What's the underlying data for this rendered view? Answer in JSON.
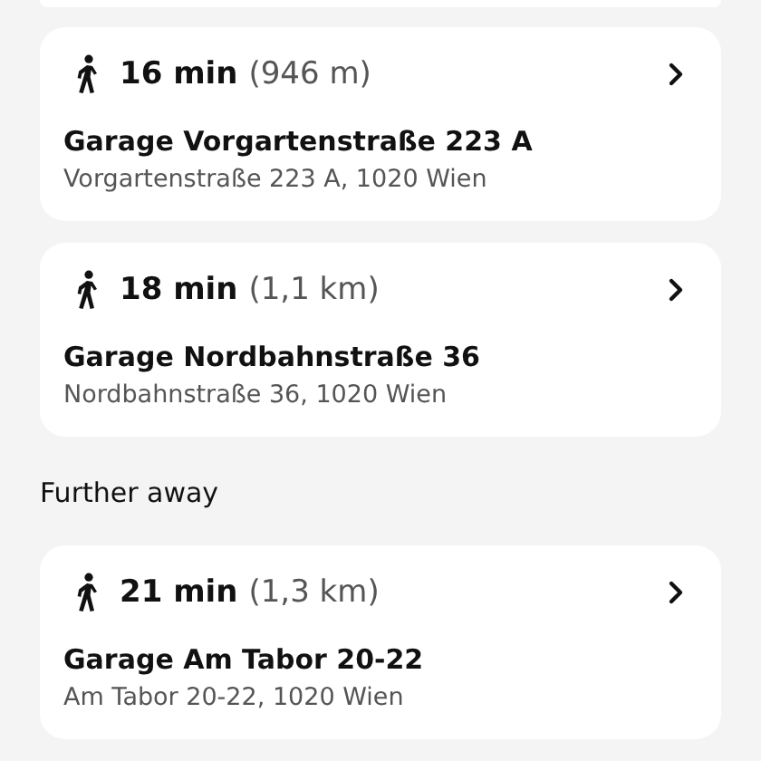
{
  "sections": [
    {
      "places": [
        {
          "walk_time": "16 min",
          "distance": "(946 m)",
          "name": "Garage Vorgartenstraße 223 A",
          "address": "Vorgartenstraße 223 A, 1020 Wien"
        },
        {
          "walk_time": "18 min",
          "distance": "(1,1 km)",
          "name": "Garage Nordbahnstraße 36",
          "address": "Nordbahnstraße 36, 1020 Wien"
        }
      ]
    },
    {
      "heading": "Further away",
      "places": [
        {
          "walk_time": "21 min",
          "distance": "(1,3 km)",
          "name": "Garage Am Tabor 20-22",
          "address": "Am Tabor 20-22, 1020 Wien"
        }
      ]
    }
  ]
}
